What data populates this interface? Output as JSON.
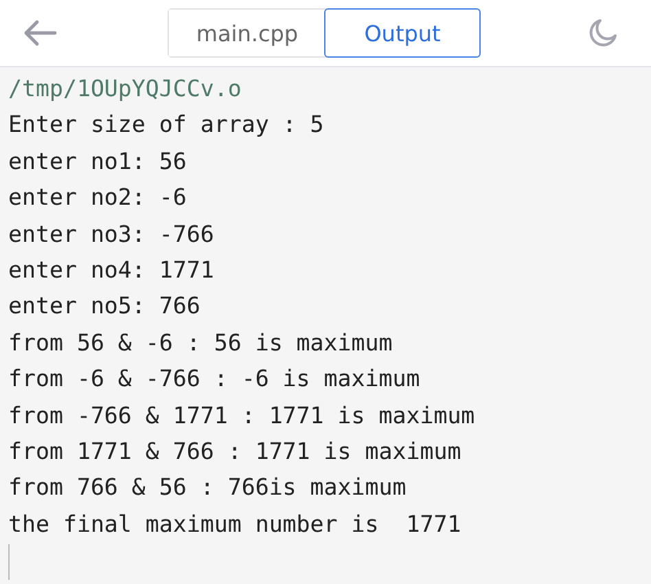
{
  "tabs": [
    {
      "label": "main.cpp",
      "selected": false
    },
    {
      "label": "Output",
      "selected": true
    }
  ],
  "console": {
    "lines": [
      {
        "kind": "path",
        "text": "/tmp/1OUpYQJCCv.o"
      },
      {
        "kind": "output",
        "text": "Enter size of array : 5"
      },
      {
        "kind": "output",
        "text": "enter no1: 56"
      },
      {
        "kind": "output",
        "text": "enter no2: -6"
      },
      {
        "kind": "output",
        "text": "enter no3: -766"
      },
      {
        "kind": "output",
        "text": "enter no4: 1771"
      },
      {
        "kind": "output",
        "text": "enter no5: 766"
      },
      {
        "kind": "output",
        "text": "from 56 & -6 : 56 is maximum"
      },
      {
        "kind": "output",
        "text": "from -6 & -766 : -6 is maximum"
      },
      {
        "kind": "output",
        "text": "from -766 & 1771 : 1771 is maximum"
      },
      {
        "kind": "output",
        "text": "from 1771 & 766 : 1771 is maximum"
      },
      {
        "kind": "output",
        "text": "from 766 & 56 : 766is maximum"
      },
      {
        "kind": "output",
        "text": "the final maximum number is  1771"
      }
    ],
    "cursor": true
  }
}
